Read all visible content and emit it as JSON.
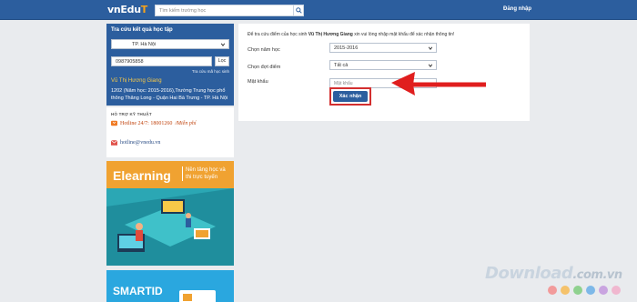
{
  "header": {
    "logo_main": "vnEdu",
    "logo_accent": "T",
    "search_placeholder": "Tìm kiếm trường học",
    "login_label": "Đăng nhập"
  },
  "sidebar": {
    "title": "Tra cứu kết quả học tập",
    "province_value": "TP. Hà Nội",
    "phone_value": "0987905858",
    "filter_button": "Lọc",
    "helper_link": "Tra cứu mã học sinh",
    "student_name": "Vũ Thị Hương Giang",
    "student_info": "1202 (Năm học: 2015-2016),Trường Trung học phổ thông Thăng Long - Quận Hai Bà Trưng - TP. Hà Nội",
    "support_title": "HỖ TRỢ KỸ THUẬT",
    "hotline": "Hotline 24/7: 18001260",
    "hotline_free": "/Miễn phí",
    "email": "hotline@vnedu.vn"
  },
  "banners": {
    "elearning_title": "Elearning",
    "elearning_sub": "Nền tảng học và thi trực tuyến",
    "smartid_title": "SMARTID"
  },
  "form": {
    "intro_prefix": "Để tra cứu điểm của học sinh",
    "intro_name": "Vũ Thị Hương Giang",
    "intro_suffix": "xin vui lòng nhập mật khẩu để xác nhận thông tin!",
    "year_label": "Chọn năm học",
    "year_value": "2015-2016",
    "term_label": "Chọn đợt điểm",
    "term_value": "Tất cả",
    "password_label": "Mật khẩu",
    "password_placeholder": "Mật khẩu",
    "submit_label": "Xác nhận"
  },
  "watermark": {
    "text": "Download",
    "suffix": ".com.vn",
    "dot_colors": [
      "#f29b9b",
      "#f5c26b",
      "#8fd18f",
      "#7db8e8",
      "#c9a4e0",
      "#f0b7cf"
    ]
  },
  "colors": {
    "header": "#2c5e9e",
    "highlight": "#d32f2f",
    "banner_orange": "#f0a231",
    "banner_blue": "#2aa7df"
  }
}
